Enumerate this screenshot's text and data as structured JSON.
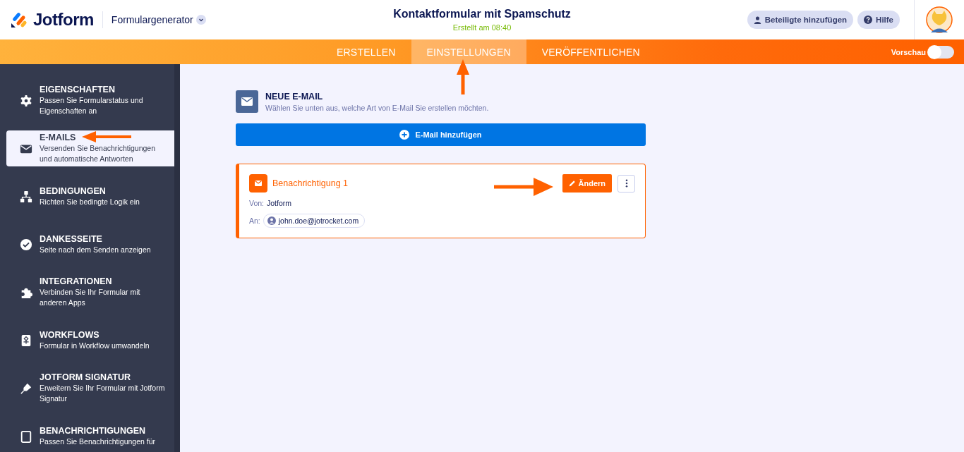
{
  "header": {
    "brand": "Jotform",
    "product": "Formulargenerator",
    "title": "Kontaktformular mit Spamschutz",
    "subtitle": "Erstellt am 08:40",
    "buttons": [
      {
        "label": "Beteiligte hinzufügen",
        "kind": "person"
      },
      {
        "label": "Hilfe",
        "kind": "help"
      }
    ]
  },
  "tabs": [
    {
      "label": "ERSTELLEN",
      "selected": false
    },
    {
      "label": "EINSTELLUNGEN",
      "selected": true
    },
    {
      "label": "VERÖFFENTLICHEN",
      "selected": false
    }
  ],
  "preview": {
    "label": "Vorschau",
    "on": false
  },
  "sidebar": {
    "items": [
      {
        "kind": "gear",
        "title": "EIGENSCHAFTEN",
        "description": "Passen Sie Formularstatus und Eigenschaften an",
        "selected": false
      },
      {
        "kind": "mail",
        "title": "E-MAILS",
        "description": "Versenden Sie Benachrichtigungen und automatische Antworten",
        "selected": true
      },
      {
        "kind": "tree",
        "title": "BEDINGUNGEN",
        "description": "Richten Sie bedingte Logik ein",
        "selected": false
      },
      {
        "kind": "check",
        "title": "DANKESSEITE",
        "description": "Seite nach dem Senden anzeigen",
        "selected": false
      },
      {
        "kind": "puzzle",
        "title": "INTEGRATIONEN",
        "description": "Verbinden Sie Ihr Formular mit anderen Apps",
        "selected": false
      },
      {
        "kind": "flow",
        "title": "WORKFLOWS",
        "description": "Formular in Workflow umwandeln",
        "selected": false
      },
      {
        "kind": "pen",
        "title": "JOTFORM SIGNATUR",
        "description": "Erweitern Sie Ihr Formular mit Jotform Signatur",
        "selected": false
      },
      {
        "kind": "phone",
        "title": "BENACHRICHTIGUNGEN",
        "description": "Passen Sie Benachrichtigungen für",
        "selected": false
      }
    ]
  },
  "section": {
    "title": "NEUE E-MAIL",
    "description": "Wählen Sie unten aus, welche Art von E-Mail Sie erstellen möchten.",
    "add_button": "E-Mail hinzufügen"
  },
  "notifications": [
    {
      "title": "Benachrichtigung 1",
      "edit_button": "Ändern",
      "from_label": "Von:",
      "from": "Jotform",
      "to_label": "An:",
      "to": "john.doe@jotrocket.com"
    }
  ]
}
